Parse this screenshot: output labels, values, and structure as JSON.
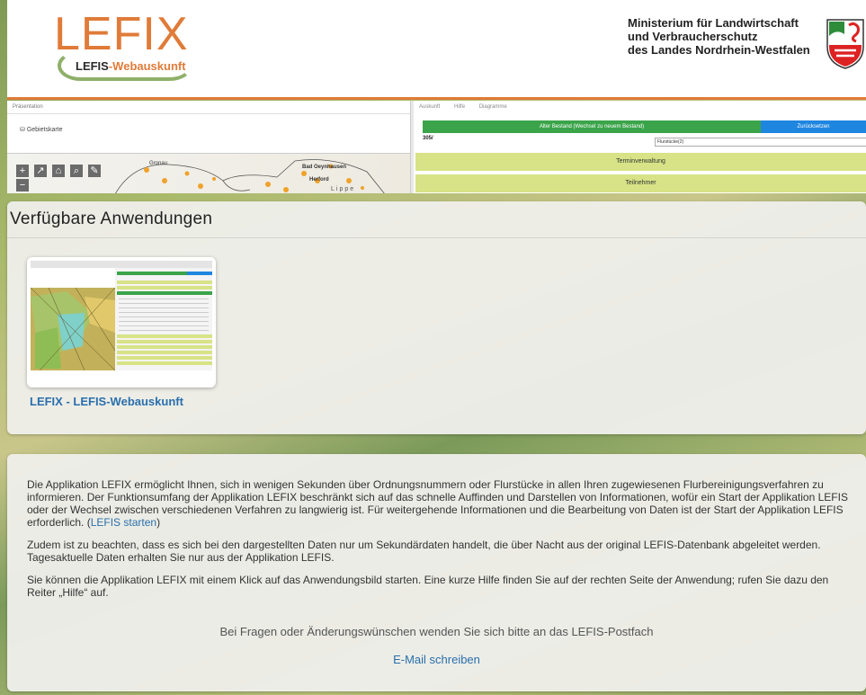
{
  "header": {
    "logo_text": "LEFIX",
    "logo_sub_1": "LEFIS",
    "logo_sub_2": "-Webauskunft",
    "ministry_line1": "Ministerium für Landwirtschaft",
    "ministry_line2": "und Verbraucherschutz",
    "ministry_line3": "des Landes Nordrhein-Westfalen",
    "accent_color": "#e07b39"
  },
  "preview": {
    "left_title": "Präsentation",
    "gebietskarte": "Gebietskarte",
    "map_labels": [
      "Gronau",
      "Bad Oeynhausen",
      "Herford",
      "Lippe"
    ],
    "tabs": [
      "Auskunft",
      "Hilfe",
      "Diagramme"
    ],
    "green_button": "Alter Bestand (Wechsel zu neuem Bestand)",
    "blue_button": "Zurücksetzen",
    "code": "305/",
    "select_value": "Flurstücke(2)",
    "bars": [
      "Terminverwaltung",
      "Teilnehmer"
    ]
  },
  "apps": {
    "heading": "Verfügbare Anwendungen",
    "items": [
      {
        "title": "LEFIX - LEFIS-Webauskunft"
      }
    ]
  },
  "info": {
    "p1_text": "Die Applikation LEFIX ermöglicht Ihnen, sich in wenigen Sekunden über Ordnungsnummern oder Flurstücke in allen Ihren zugewiesenen Flurbereinigungsverfahren zu informieren. Der Funktionsumfang der Applikation LEFIX beschränkt sich auf das schnelle Auffinden und Darstellen von Informationen, wofür ein Start der Applikation LEFIS oder der Wechsel zwischen verschiedenen Verfahren zu langwierig ist. Für weitergehende Informationen und die Bearbeitung von Daten ist der Start der Applikation LEFIS erforderlich. (",
    "p1_link": "LEFIS starten",
    "p1_end": ")",
    "p2": "Zudem ist zu beachten, dass es sich bei den dargestellten Daten nur um Sekundärdaten handelt, die über Nacht aus der original LEFIS-Datenbank abgeleitet werden. Tagesaktuelle Daten erhalten Sie nur aus der Applikation LEFIS.",
    "p3": "Sie können die Applikation LEFIX mit einem Klick auf das Anwendungsbild starten. Eine kurze Hilfe finden Sie auf der rechten Seite der Anwendung; rufen Sie dazu den Reiter „Hilfe“ auf.",
    "contact": "Bei Fragen oder Änderungswünschen wenden Sie sich bitte an das LEFIS-Postfach",
    "mail_link": "E-Mail schreiben"
  }
}
